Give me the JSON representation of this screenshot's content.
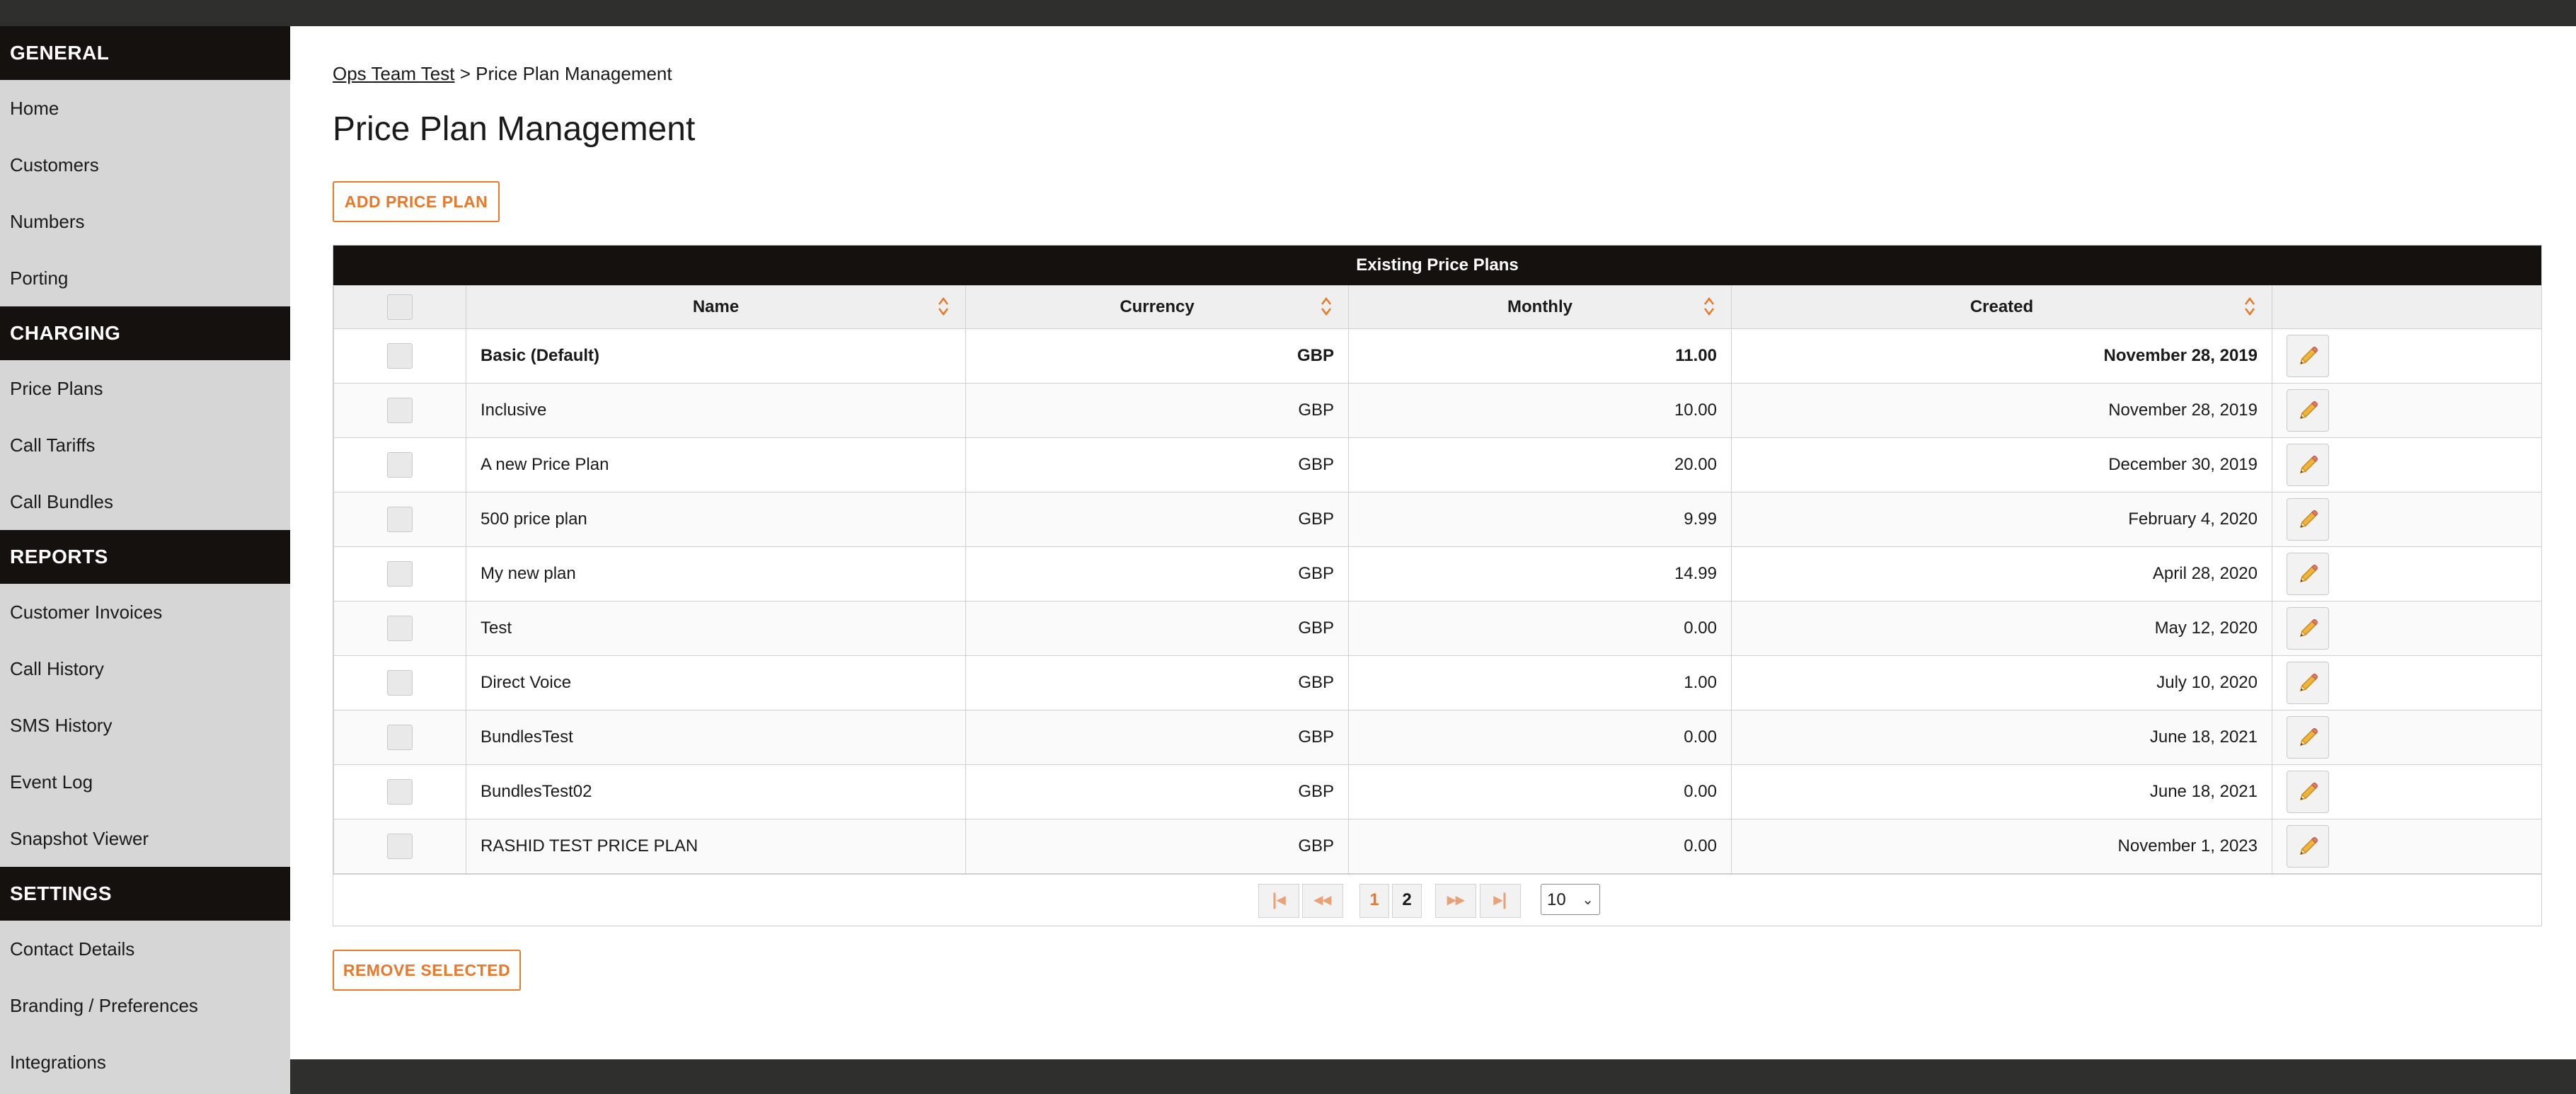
{
  "sidebar": {
    "sections": [
      {
        "title": "GENERAL",
        "items": [
          "Home",
          "Customers",
          "Numbers",
          "Porting"
        ]
      },
      {
        "title": "CHARGING",
        "items": [
          "Price Plans",
          "Call Tariffs",
          "Call Bundles"
        ]
      },
      {
        "title": "REPORTS",
        "items": [
          "Customer Invoices",
          "Call History",
          "SMS History",
          "Event Log",
          "Snapshot Viewer"
        ]
      },
      {
        "title": "SETTINGS",
        "items": [
          "Contact Details",
          "Branding / Preferences",
          "Integrations"
        ]
      }
    ]
  },
  "breadcrumb": {
    "parent": "Ops Team Test",
    "separator": ">",
    "current": "Price Plan Management"
  },
  "page_title": "Price Plan Management",
  "buttons": {
    "add": "ADD PRICE PLAN",
    "remove": "REMOVE SELECTED"
  },
  "table": {
    "title": "Existing Price Plans",
    "headers": {
      "name": "Name",
      "currency": "Currency",
      "monthly": "Monthly",
      "created": "Created"
    },
    "rows": [
      {
        "name": "Basic (Default)",
        "currency": "GBP",
        "monthly": "11.00",
        "created": "November 28, 2019",
        "bold": true
      },
      {
        "name": "Inclusive",
        "currency": "GBP",
        "monthly": "10.00",
        "created": "November 28, 2019"
      },
      {
        "name": "A new Price Plan",
        "currency": "GBP",
        "monthly": "20.00",
        "created": "December 30, 2019"
      },
      {
        "name": "500 price plan",
        "currency": "GBP",
        "monthly": "9.99",
        "created": "February 4, 2020"
      },
      {
        "name": "My new plan",
        "currency": "GBP",
        "monthly": "14.99",
        "created": "April 28, 2020"
      },
      {
        "name": "Test",
        "currency": "GBP",
        "monthly": "0.00",
        "created": "May 12, 2020"
      },
      {
        "name": "Direct Voice",
        "currency": "GBP",
        "monthly": "1.00",
        "created": "July 10, 2020"
      },
      {
        "name": "BundlesTest",
        "currency": "GBP",
        "monthly": "0.00",
        "created": "June 18, 2021"
      },
      {
        "name": "BundlesTest02",
        "currency": "GBP",
        "monthly": "0.00",
        "created": "June 18, 2021"
      },
      {
        "name": "RASHID TEST PRICE PLAN",
        "currency": "GBP",
        "monthly": "0.00",
        "created": "November 1, 2023"
      }
    ]
  },
  "pagination": {
    "first": "|◂",
    "prev": "◂◂",
    "pages": [
      "1",
      "2"
    ],
    "active_page": "1",
    "next": "▸▸",
    "last": "▸|",
    "page_size": "10"
  },
  "icons": {
    "sort": "sort-icon",
    "edit": "pencil-icon",
    "caret": "chevron-down-icon"
  },
  "colors": {
    "accent": "#e8782a",
    "header_dark": "#15110e",
    "topbar": "#2f2f2d",
    "sidebar_bg": "#d6d6d6"
  }
}
